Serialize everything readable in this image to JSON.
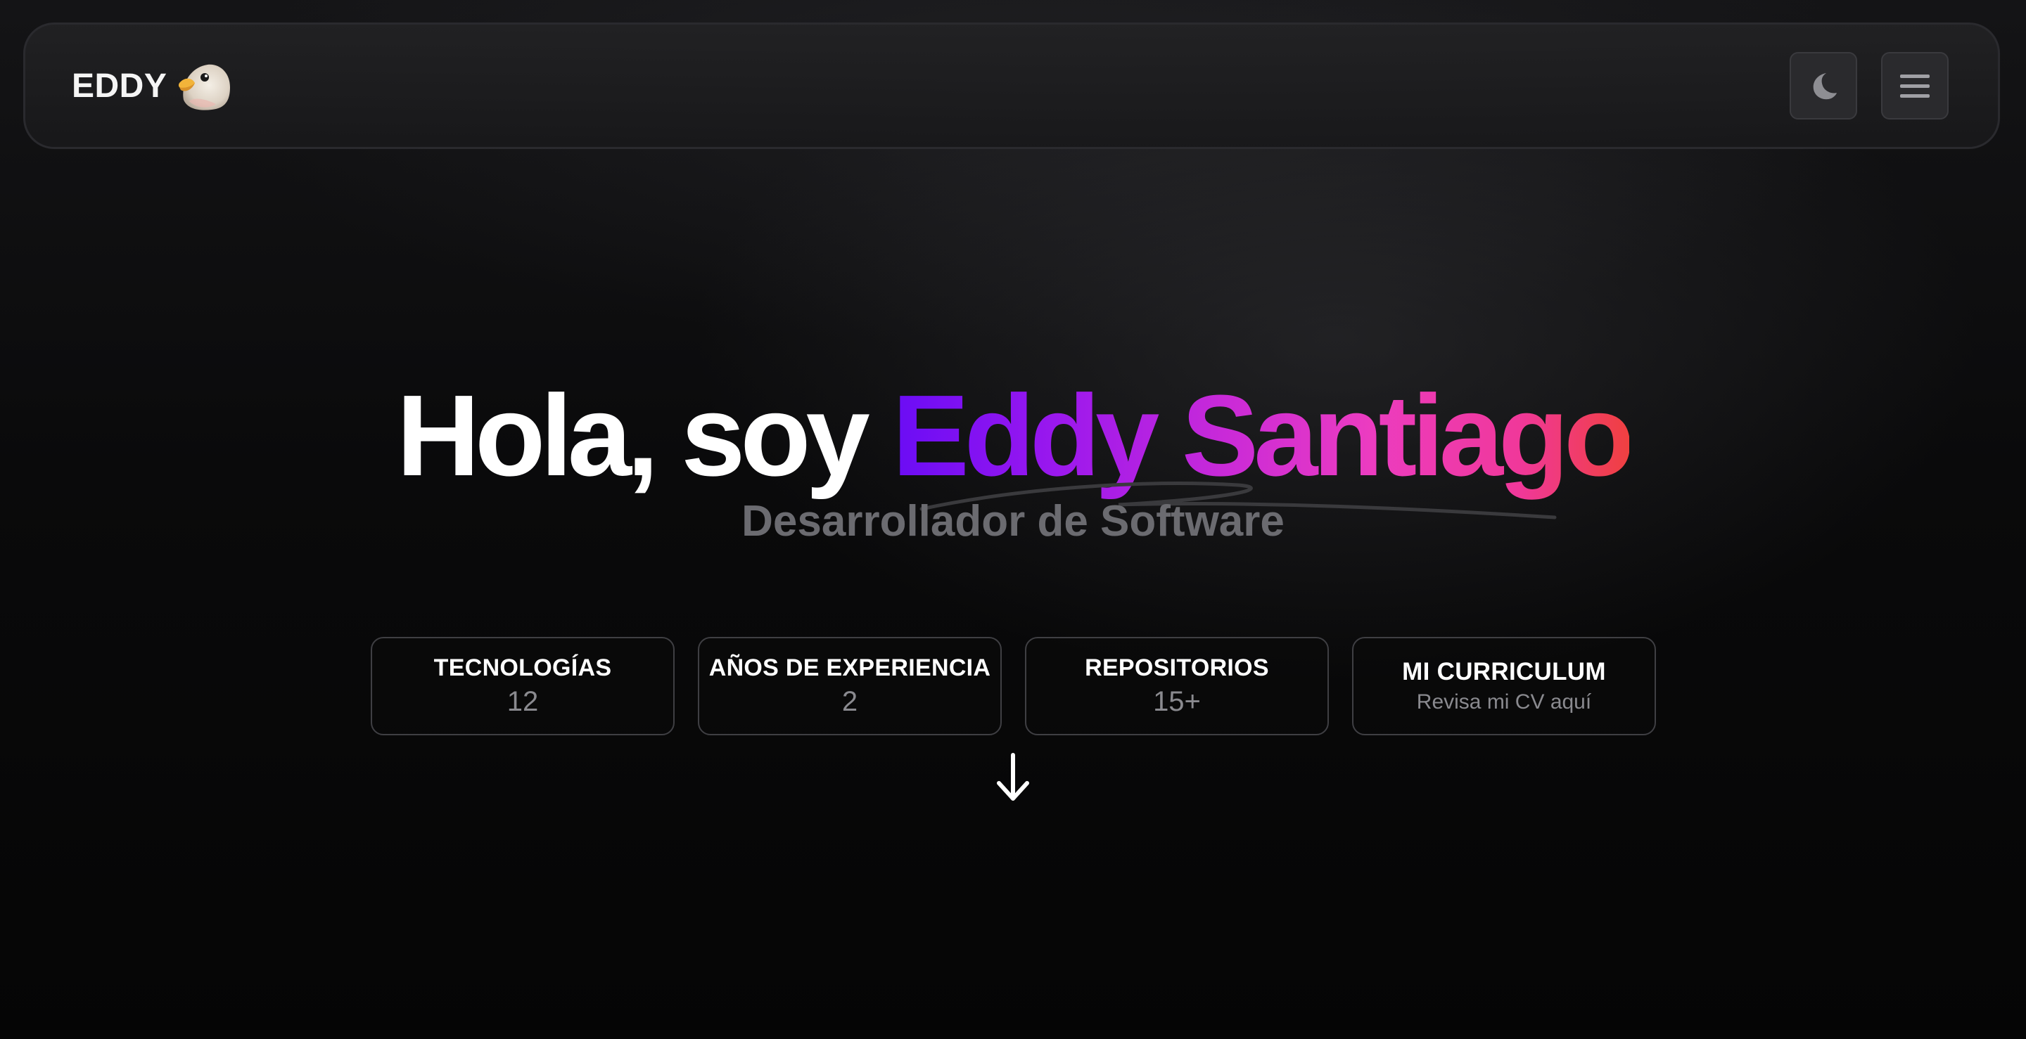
{
  "navbar": {
    "brand": "EDDY",
    "brand_icon": "bird-avatar-icon",
    "theme_toggle_icon": "moon-icon",
    "menu_icon": "hamburger-menu-icon"
  },
  "hero": {
    "greeting": "Hola, soy",
    "name": "Eddy Santiago",
    "subtitle": "Desarrollador de Software",
    "name_gradient": [
      "#6a0cf5",
      "#c92ad8",
      "#ec3cc0",
      "#f04040"
    ]
  },
  "stats": [
    {
      "label": "TECNOLOGÍAS",
      "value": "12"
    },
    {
      "label": "AÑOS DE EXPERIENCIA",
      "value": "2"
    },
    {
      "label": "REPOSITORIOS",
      "value": "15+"
    },
    {
      "label": "MI CURRICULUM",
      "value": "Revisa mi CV aquí"
    }
  ],
  "scroll_indicator_icon": "arrow-down-icon"
}
